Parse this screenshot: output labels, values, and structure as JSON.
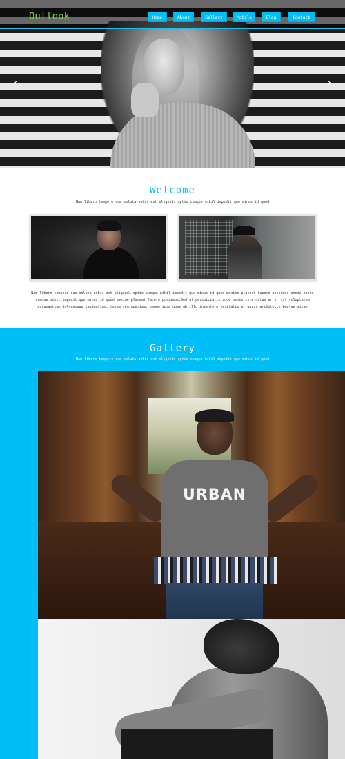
{
  "site": {
    "logo": "Outlook"
  },
  "nav": {
    "items": [
      {
        "label": "Home",
        "name": "nav-home"
      },
      {
        "label": "About",
        "name": "nav-about"
      },
      {
        "label": "Gallery",
        "name": "nav-gallery"
      },
      {
        "label": "Mobile",
        "name": "nav-mobile"
      },
      {
        "label": "Blog",
        "name": "nav-blog"
      },
      {
        "label": "Contact",
        "name": "nav-contact"
      }
    ]
  },
  "slider": {
    "prev": "‹",
    "next": "›"
  },
  "welcome": {
    "title": "Welcome",
    "subtitle": "Nam libero tempore cum soluta nobis est eligendi optio cumque nihil impedit quo minus id quod",
    "body": "Nam libero tempore cum soluta nobis est eligendi optio cumque nihil impedit quo minus id quod maxime placeat facere possimus omnis optio cumque nihil impedit quo minus id quod maxime placeat facere possimus.Sed ut perspiciatis unde omnis iste natus error sit voluptatem accusantium doloremque laudantium, totam rem aperiam, eaque ipsa quae ab illo inventore veritatis et quasi architecto beatae vitae"
  },
  "gallery": {
    "title": "Gallery",
    "subtitle": "Nam libero tempore cum soluta nobis est eligendi optio cumque nihil impedit quo minus id quod",
    "shirt_text": "URBAN"
  },
  "colors": {
    "accent": "#00bff7",
    "logo": "#7bd147"
  }
}
